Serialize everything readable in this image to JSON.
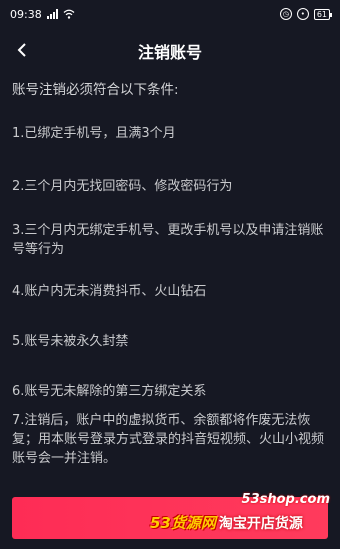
{
  "status_bar": {
    "time": "09:38",
    "signal": "5Gll",
    "battery": "61"
  },
  "nav": {
    "title": "注销账号",
    "back_icon": "chevron-left-icon"
  },
  "intro": "账号注销必须符合以下条件:",
  "conditions": [
    "1.已绑定手机号，且满3个月",
    "2.三个月内无找回密码、修改密码行为",
    "3.三个月内无绑定手机号、更改手机号以及申请注销账号等行为",
    "4.账户内无未消费抖币、火山钻石",
    "5.账号未被永久封禁",
    "6.账号无未解除的第三方绑定关系",
    "7.注销后，账户中的虚拟货币、余额都将作废无法恢复；用本账号登录方式登录的抖音短视频、火山小视频账号会一并注销。"
  ],
  "watermark": {
    "domain": "53shop.com",
    "brand": "53货源网",
    "slogan": "淘宝开店货源"
  },
  "colors": {
    "background": "#161823",
    "accent": "#fe2c55"
  }
}
